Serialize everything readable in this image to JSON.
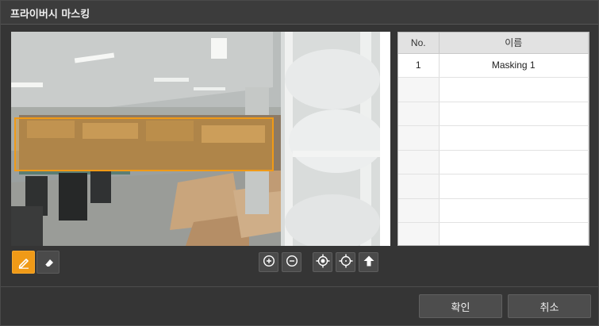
{
  "window": {
    "title": "프라이버시 마스킹"
  },
  "video": {
    "mask_color": "#f09a17",
    "mask_label": "Masking 1"
  },
  "tools": {
    "draw": {
      "icon": "pencil-icon",
      "active": true
    },
    "erase": {
      "icon": "eraser-icon",
      "active": false
    }
  },
  "controls": [
    {
      "icon": "zoom-in-icon"
    },
    {
      "icon": "zoom-out-icon"
    },
    {
      "icon": "center-target-icon"
    },
    {
      "icon": "crosshair-icon"
    },
    {
      "icon": "arrow-up-icon"
    }
  ],
  "table": {
    "columns": [
      "No.",
      "이름"
    ],
    "rows": [
      {
        "no": "1",
        "name": "Masking 1"
      },
      {
        "no": "",
        "name": ""
      },
      {
        "no": "",
        "name": ""
      },
      {
        "no": "",
        "name": ""
      },
      {
        "no": "",
        "name": ""
      },
      {
        "no": "",
        "name": ""
      },
      {
        "no": "",
        "name": ""
      },
      {
        "no": "",
        "name": ""
      }
    ]
  },
  "footer": {
    "ok_label": "확인",
    "cancel_label": "취소"
  }
}
